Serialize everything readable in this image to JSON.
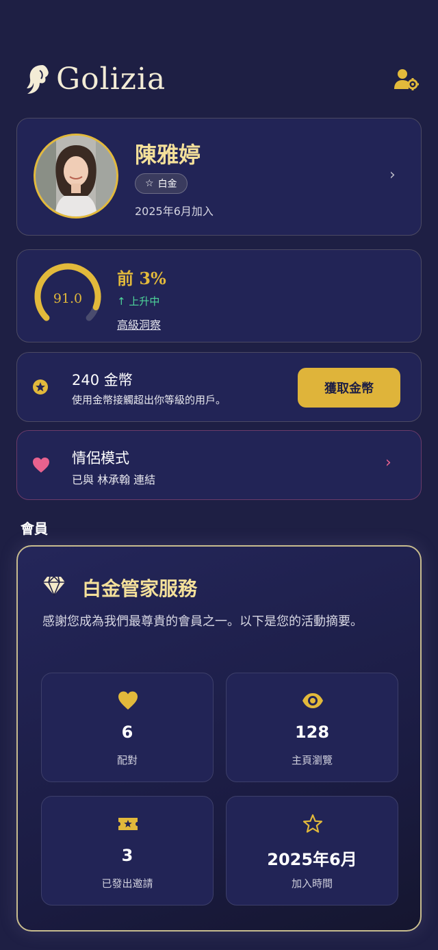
{
  "brand": {
    "name": "Golizia"
  },
  "profile": {
    "name": "陳雅婷",
    "tier_label": "白金",
    "join_date": "2025年6月加入"
  },
  "ranking": {
    "score": "91.0",
    "score_value": 91.0,
    "percentile": "前 3%",
    "trend": "上升中",
    "insights_link": "高級洞察"
  },
  "coins": {
    "title": "240 金幣",
    "description": "使用金幣接觸超出你等級的用戶。",
    "button": "獲取金幣"
  },
  "couple": {
    "title": "情侶模式",
    "description": "已與 林承翰 連結"
  },
  "membership": {
    "section_label": "會員",
    "title": "白金管家服務",
    "description": "感謝您成為我們最尊貴的會員之一。以下是您的活動摘要。",
    "stats": [
      {
        "value": "6",
        "label": "配對",
        "icon": "heart-icon"
      },
      {
        "value": "128",
        "label": "主頁瀏覽",
        "icon": "eye-icon"
      },
      {
        "value": "3",
        "label": "已發出邀請",
        "icon": "ticket-icon"
      },
      {
        "value": "2025年6月",
        "label": "加入時間",
        "icon": "star-icon"
      }
    ]
  },
  "colors": {
    "background": "#1e1f44",
    "card": "#222456",
    "gold": "#e2b93b",
    "name_gold": "#f4e09a",
    "trend_green": "#4ed69a",
    "heart_pink": "#e8628e"
  }
}
